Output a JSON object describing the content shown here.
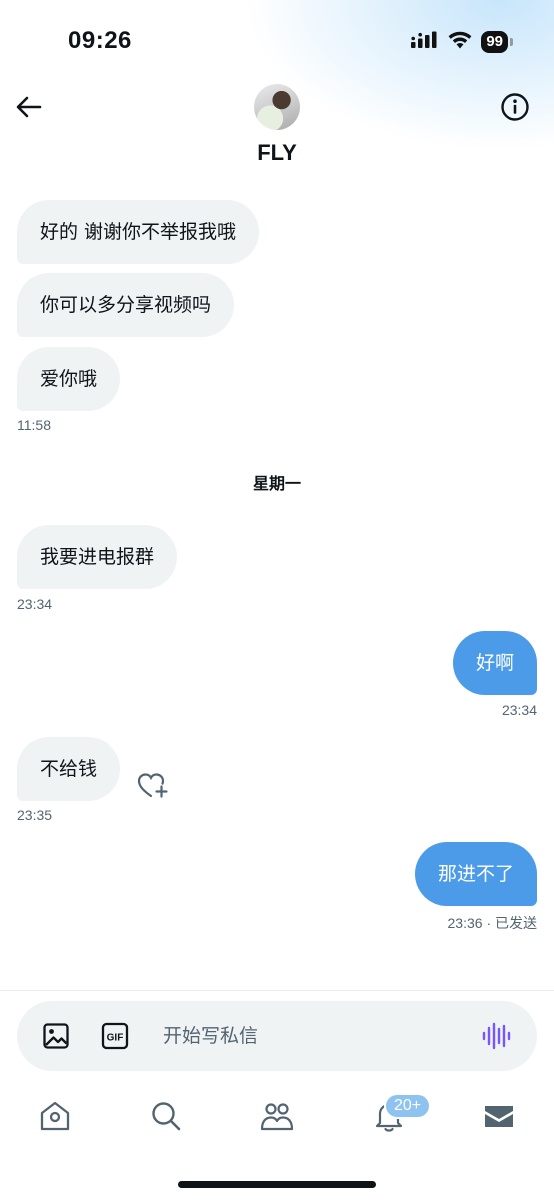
{
  "status_bar": {
    "time": "09:26",
    "battery": "99"
  },
  "header": {
    "contact_name": "FLY"
  },
  "messages": [
    {
      "text": "好的 谢谢你不举报我哦",
      "side": "in"
    },
    {
      "text": "你可以多分享视频吗",
      "side": "in"
    },
    {
      "text": "爱你哦",
      "side": "in",
      "time": "11:58"
    },
    {
      "text": "我要进电报群",
      "side": "in",
      "time": "23:34"
    },
    {
      "text": "好啊",
      "side": "out",
      "time": "23:34"
    },
    {
      "text": "不给钱",
      "side": "in",
      "time": "23:35"
    },
    {
      "text": "那进不了",
      "side": "out",
      "time": "23:36 · 已发送"
    }
  ],
  "day_separator": "星期一",
  "composer": {
    "placeholder": "开始写私信",
    "gif_label": "GIF"
  },
  "nav": {
    "notifications_badge": "20+"
  },
  "colors": {
    "outgoing_bubble": "#4c9be8",
    "incoming_bubble": "#eff3f4",
    "voice_icon": "#7856ff"
  }
}
